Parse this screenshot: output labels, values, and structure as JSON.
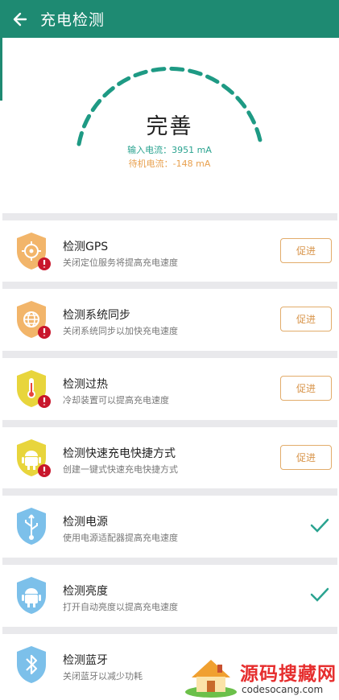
{
  "header": {
    "title": "充电检测",
    "back_icon": "arrow-left-icon",
    "color": "#1e8a72"
  },
  "hero": {
    "status": "完善",
    "input_current": "输入电流：3951 mA",
    "standby_current": "待机电流：-148 mA",
    "colors": {
      "arc": "#1e9a84",
      "input": "#2aa390",
      "standby": "#e8a04e"
    }
  },
  "items": [
    {
      "title": "检测GPS",
      "subtitle": "关闭定位服务将提高充电速度",
      "icon": "gps-shield-icon",
      "action": "促进",
      "state": "warning"
    },
    {
      "title": "检测系统同步",
      "subtitle": "关闭系统同步以加快充电速度",
      "icon": "sync-shield-icon",
      "action": "促进",
      "state": "warning"
    },
    {
      "title": "检测过热",
      "subtitle": "冷却装置可以提高充电速度",
      "icon": "thermometer-shield-icon",
      "action": "促进",
      "state": "warning"
    },
    {
      "title": "检测快速充电快捷方式",
      "subtitle": "创建一键式快速充电快捷方式",
      "icon": "android-shield-icon",
      "action": "促进",
      "state": "warning"
    },
    {
      "title": "检测电源",
      "subtitle": "使用电源适配器提高充电速度",
      "icon": "usb-shield-icon",
      "state": "ok"
    },
    {
      "title": "检测亮度",
      "subtitle": "打开自动亮度以提高充电速度",
      "icon": "android-shield-icon",
      "state": "ok"
    },
    {
      "title": "检测蓝牙",
      "subtitle": "关闭蓝牙以减少功耗",
      "icon": "bluetooth-shield-icon",
      "state": "ok"
    }
  ],
  "watermark": {
    "title": "源码搜藏网",
    "url": "codesocang.com"
  }
}
